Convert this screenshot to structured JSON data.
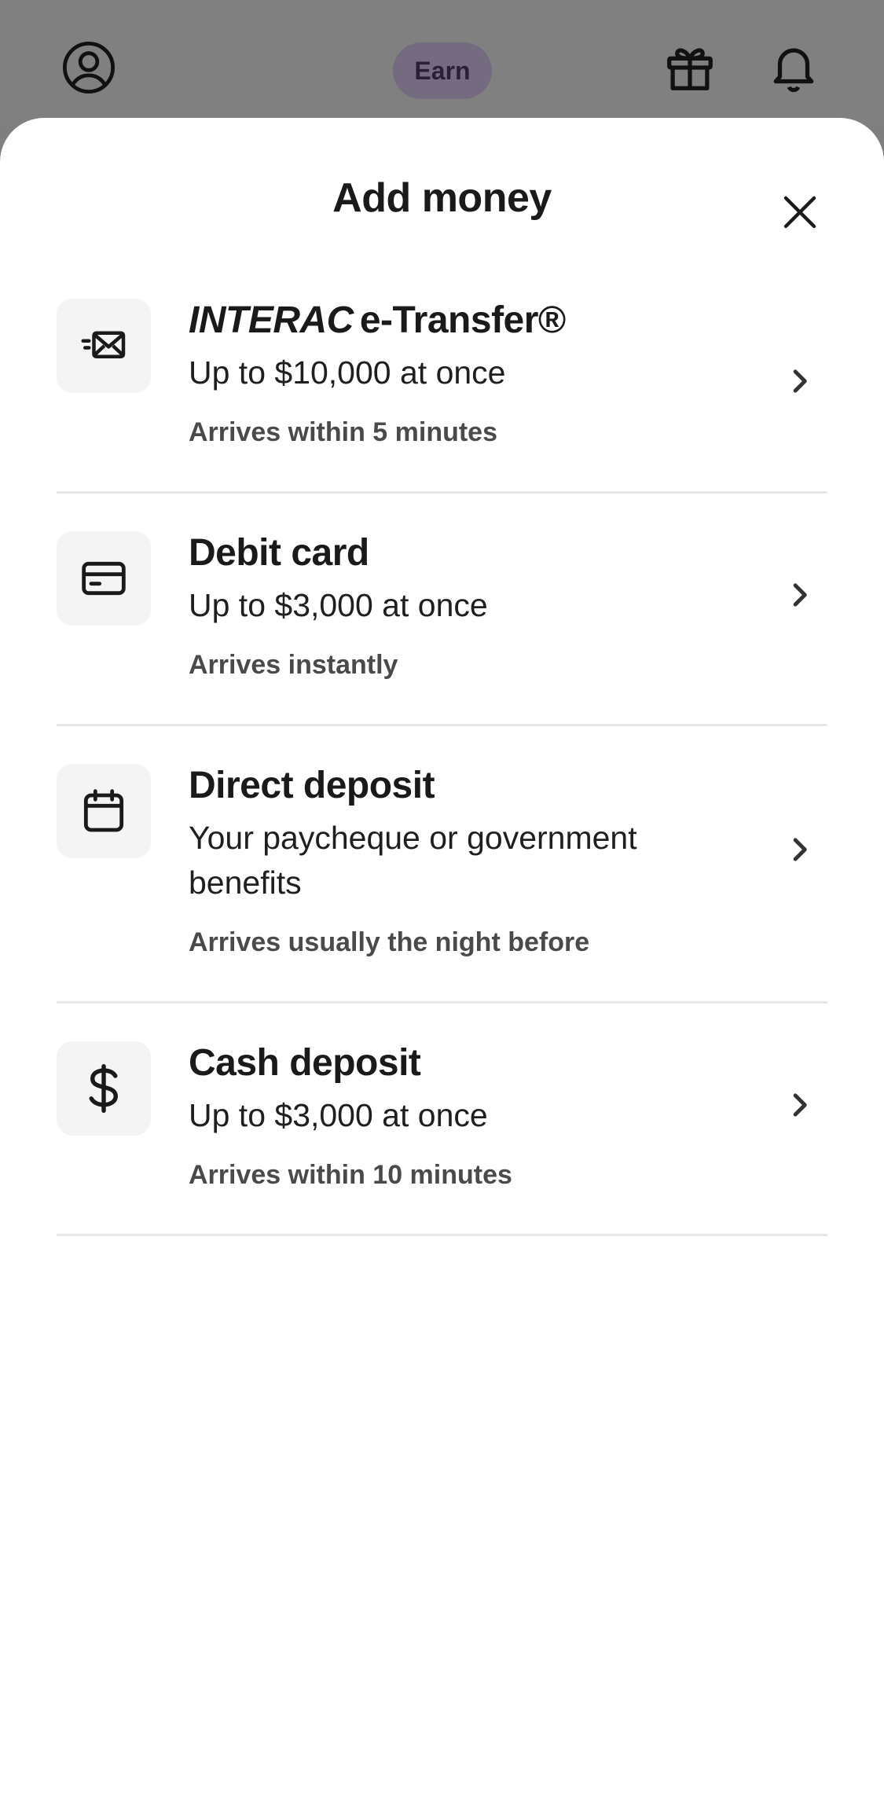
{
  "topbar": {
    "earn_label": "Earn"
  },
  "sheet": {
    "title": "Add money"
  },
  "options": [
    {
      "title_brand": "INTERAC",
      "title_rest": "e-Transfer®",
      "subtitle": "Up to $10,000 at once",
      "meta": "Arrives within 5 minutes",
      "icon": "mail-fast-icon"
    },
    {
      "title": "Debit card",
      "subtitle": "Up to $3,000 at once",
      "meta": "Arrives instantly",
      "icon": "credit-card-icon"
    },
    {
      "title": "Direct deposit",
      "subtitle": "Your paycheque or government benefits",
      "meta": "Arrives usually the night before",
      "icon": "calendar-icon"
    },
    {
      "title": "Cash deposit",
      "subtitle": "Up to $3,000 at once",
      "meta": "Arrives within 10 minutes",
      "icon": "dollar-icon"
    }
  ],
  "colors": {
    "overlay": "#808080",
    "earn_pill": "#756b80",
    "icon_box": "#f4f4f4",
    "divider": "#e6e6e6"
  }
}
